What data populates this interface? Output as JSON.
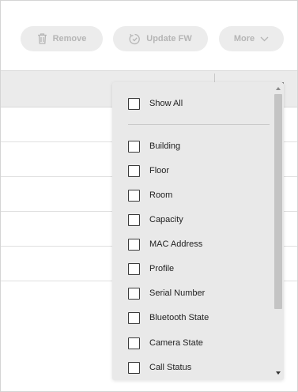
{
  "toolbar": {
    "remove_label": "Remove",
    "remove_icon": "trash-icon",
    "update_label": "Update FW",
    "update_icon": "refresh-clock-icon",
    "more_label": "More",
    "more_icon": "chevron-down-icon"
  },
  "column_menu": {
    "show_all_label": "Show All",
    "options": [
      "Building",
      "Floor",
      "Room",
      "Capacity",
      "MAC Address",
      "Profile",
      "Serial Number",
      "Bluetooth State",
      "Camera State",
      "Call Status"
    ]
  },
  "colors": {
    "disabled_button_bg": "#ececec",
    "disabled_button_text": "#b5b5b5",
    "menu_bg": "#e9e9e9",
    "header_bg": "#ebebeb"
  }
}
